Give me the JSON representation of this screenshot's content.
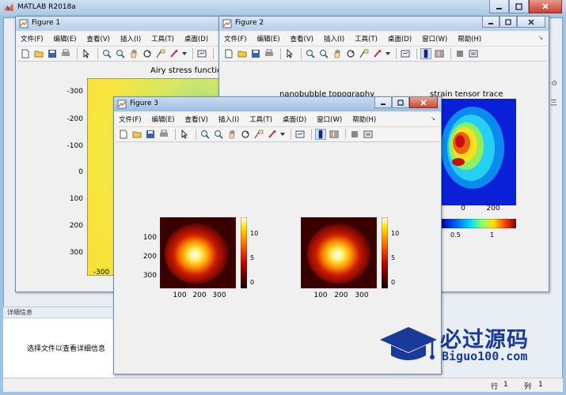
{
  "main": {
    "title": "MATLAB R2018a",
    "details_header": "详细信息",
    "details_text": "选择文件以查看详细信息",
    "status_row_label": "行",
    "status_row_value": "1",
    "status_col_label": "列",
    "status_col_value": "1",
    "right_strip": [
      "⊙",
      "三"
    ]
  },
  "menus": [
    "文件(F)",
    "编辑(E)",
    "查看(V)",
    "插入(I)",
    "工具(T)",
    "桌面(D)",
    "窗口(W)",
    "帮助(H)"
  ],
  "figure1": {
    "title": "Figure 1",
    "menu_visible": [
      "文件(F)",
      "编辑(E)",
      "查看(V)",
      "插入(I)",
      "工具(T)",
      "桌面(D)",
      "窗"
    ],
    "axes_title": "Airy stress functio",
    "yticks": [
      "-300",
      "-200",
      "-100",
      "0",
      "100",
      "200",
      "300"
    ],
    "xticks": [
      "-300"
    ]
  },
  "figure2": {
    "title": "Figure 2",
    "left_axes_title": "nanobubble topography",
    "right_axes_title": "strain tensor trace",
    "xticks": [
      "0",
      "200"
    ],
    "cb_ticks": [
      "0.5",
      "1"
    ]
  },
  "figure3": {
    "title": "Figure 3",
    "left_yticks": [
      "100",
      "200",
      "300"
    ],
    "left_xticks": [
      "100",
      "200",
      "300"
    ],
    "right_xticks": [
      "100",
      "200",
      "300"
    ],
    "cb_ticks": [
      "10",
      "5",
      "0"
    ]
  },
  "watermark": {
    "text": "必过源码",
    "url": "Biguo100.com"
  },
  "colors": {
    "title_bar": "#a9c7e6",
    "close_button": "#c8402c",
    "watermark": "#1a3a99"
  }
}
